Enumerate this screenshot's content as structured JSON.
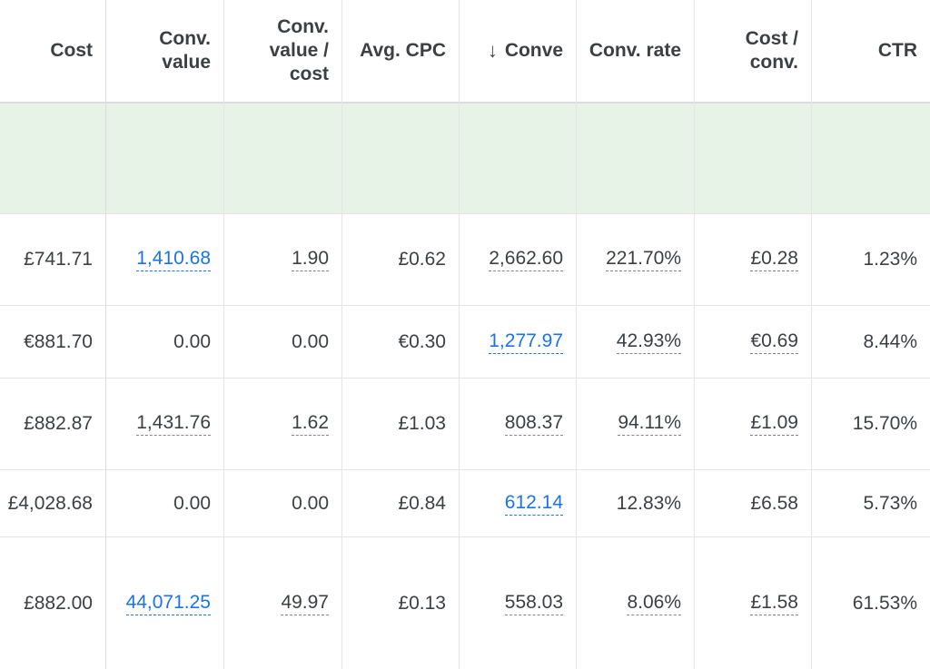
{
  "headers": [
    {
      "key": "cost",
      "label": "Cost"
    },
    {
      "key": "conv_value",
      "label": "Conv.\nvalue"
    },
    {
      "key": "conv_value_cost",
      "label": "Conv.\nvalue /\ncost"
    },
    {
      "key": "avg_cpc",
      "label": "Avg. CPC"
    },
    {
      "key": "conversions",
      "label": "Conve",
      "sorted": "descending",
      "sort_icon": "arrow-down-icon",
      "sort_glyph": "↓"
    },
    {
      "key": "conv_rate",
      "label": "Conv. rate"
    },
    {
      "key": "cost_per_conv",
      "label": "Cost /\nconv."
    },
    {
      "key": "ctr",
      "label": "CTR"
    }
  ],
  "rows": [
    {
      "cells": [
        {
          "value": "£741.71",
          "style": "plain"
        },
        {
          "value": "1,410.68",
          "style": "link"
        },
        {
          "value": "1.90",
          "style": "dotted"
        },
        {
          "value": "£0.62",
          "style": "plain"
        },
        {
          "value": "2,662.60",
          "style": "dotted"
        },
        {
          "value": "221.70%",
          "style": "dotted"
        },
        {
          "value": "£0.28",
          "style": "dotted"
        },
        {
          "value": "1.23%",
          "style": "plain"
        }
      ]
    },
    {
      "cells": [
        {
          "value": "€881.70",
          "style": "plain"
        },
        {
          "value": "0.00",
          "style": "plain"
        },
        {
          "value": "0.00",
          "style": "plain"
        },
        {
          "value": "€0.30",
          "style": "plain"
        },
        {
          "value": "1,277.97",
          "style": "link"
        },
        {
          "value": "42.93%",
          "style": "dotted"
        },
        {
          "value": "€0.69",
          "style": "dotted"
        },
        {
          "value": "8.44%",
          "style": "plain"
        }
      ]
    },
    {
      "cells": [
        {
          "value": "£882.87",
          "style": "plain"
        },
        {
          "value": "1,431.76",
          "style": "dotted"
        },
        {
          "value": "1.62",
          "style": "dotted"
        },
        {
          "value": "£1.03",
          "style": "plain"
        },
        {
          "value": "808.37",
          "style": "dotted"
        },
        {
          "value": "94.11%",
          "style": "dotted"
        },
        {
          "value": "£1.09",
          "style": "dotted"
        },
        {
          "value": "15.70%",
          "style": "plain"
        }
      ]
    },
    {
      "cells": [
        {
          "value": "£4,028.68",
          "style": "plain"
        },
        {
          "value": "0.00",
          "style": "plain"
        },
        {
          "value": "0.00",
          "style": "plain"
        },
        {
          "value": "£0.84",
          "style": "plain"
        },
        {
          "value": "612.14",
          "style": "link"
        },
        {
          "value": "12.83%",
          "style": "plain"
        },
        {
          "value": "£6.58",
          "style": "plain"
        },
        {
          "value": "5.73%",
          "style": "plain"
        }
      ]
    },
    {
      "cells": [
        {
          "value": "£882.00",
          "style": "plain"
        },
        {
          "value": "44,071.25",
          "style": "link"
        },
        {
          "value": "49.97",
          "style": "dotted"
        },
        {
          "value": "£0.13",
          "style": "plain"
        },
        {
          "value": "558.03",
          "style": "dotted"
        },
        {
          "value": "8.06%",
          "style": "dotted"
        },
        {
          "value": "£1.58",
          "style": "dotted"
        },
        {
          "value": "61.53%",
          "style": "plain"
        }
      ]
    }
  ],
  "colors": {
    "text": "#3c4043",
    "link": "#1a73e8",
    "total_row_bg": "#e8f3e8",
    "grid_line": "#e3e5e8"
  }
}
